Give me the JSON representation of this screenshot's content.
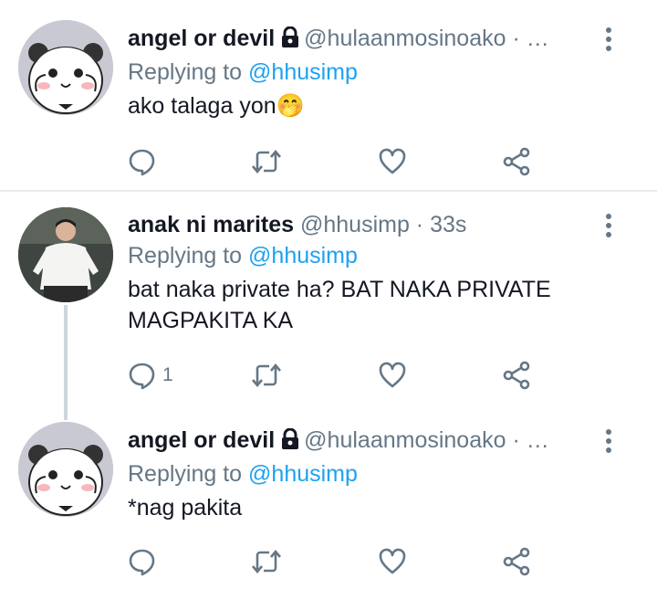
{
  "tweets": [
    {
      "name": "angel or devil",
      "handle": "@hulaanmosinoako · …",
      "reply_prefix": "Replying to",
      "reply_to": "@hhusimp",
      "text": "ako talaga yon🤭",
      "reply_count": "",
      "avatar": "panda-cartoon"
    },
    {
      "name": "anak ni marites",
      "handle": "@hhusimp · 33s",
      "reply_prefix": "Replying to",
      "reply_to": "@hhusimp",
      "text": "bat naka private ha? BAT NAKA PRIVATE MAGPAKITA KA",
      "reply_count": "1",
      "avatar": "person-photo"
    },
    {
      "name": "angel or devil",
      "handle": "@hulaanmosinoako · …",
      "reply_prefix": "Replying to",
      "reply_to": "@hhusimp",
      "text": "*nag pakita",
      "reply_count": "",
      "avatar": "panda-cartoon"
    }
  ],
  "icons": [
    "reply-icon",
    "retweet-icon",
    "like-icon",
    "share-icon",
    "lock-icon",
    "more-icon"
  ],
  "colors": {
    "accent": "#1da1f2",
    "secondary": "#657786",
    "text": "#141823",
    "divider": "#e6ecf0"
  }
}
